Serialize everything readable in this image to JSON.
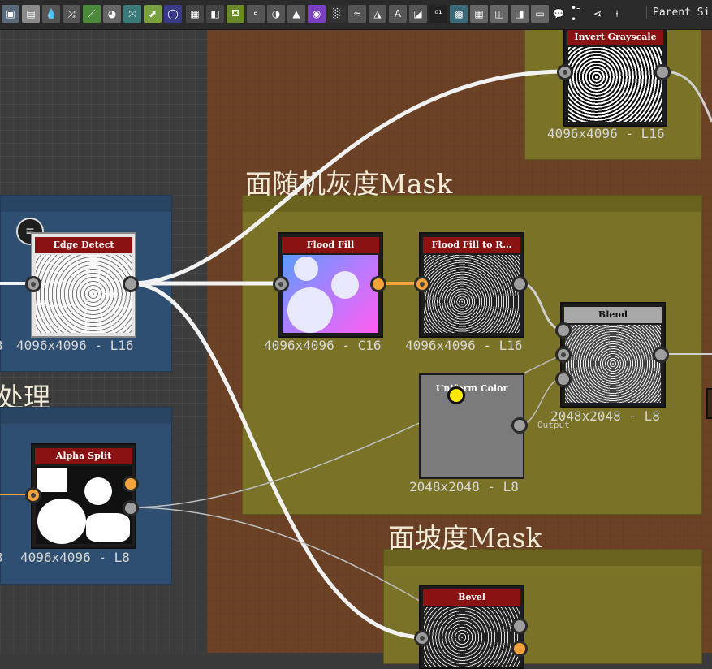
{
  "toolbar": {
    "parent_label": "Parent Si",
    "icons": [
      {
        "name": "image-icon",
        "glyph": "▣",
        "color": "#5a6a7a"
      },
      {
        "name": "bitmap-icon",
        "glyph": "▤",
        "color": "#8a8a8a"
      },
      {
        "name": "drop-icon",
        "glyph": "💧",
        "color": "#555555"
      },
      {
        "name": "shuffle-icon",
        "glyph": "⤨",
        "color": "#555555"
      },
      {
        "name": "curve-icon",
        "glyph": "⟋",
        "color": "#4a8a3a"
      },
      {
        "name": "paint-icon",
        "glyph": "◕",
        "color": "#666666"
      },
      {
        "name": "transform-icon",
        "glyph": "⤧",
        "color": "#3a7a7a"
      },
      {
        "name": "gradient-icon",
        "glyph": "⬈",
        "color": "#7aa040"
      },
      {
        "name": "circle-icon",
        "glyph": "◯",
        "color": "#3a3a8a"
      },
      {
        "name": "grid-icon",
        "glyph": "▦",
        "color": "#444444"
      },
      {
        "name": "bucket-icon",
        "glyph": "◧",
        "color": "#444444"
      },
      {
        "name": "watering-icon",
        "glyph": "⛾",
        "color": "#6a8a2a"
      },
      {
        "name": "slider-icon",
        "glyph": "⚬",
        "color": "#555555"
      },
      {
        "name": "contrast-icon",
        "glyph": "◑",
        "color": "#555555"
      },
      {
        "name": "histogram-icon",
        "glyph": "▲",
        "color": "#555555"
      },
      {
        "name": "color-wheel-icon",
        "glyph": "◉",
        "color": "#7a40c0"
      },
      {
        "name": "noise-icon",
        "glyph": "░",
        "color": "#333333"
      },
      {
        "name": "warp-icon",
        "glyph": "≈",
        "color": "#555555"
      },
      {
        "name": "mirror-icon",
        "glyph": "◮",
        "color": "#555555"
      },
      {
        "name": "text-icon",
        "glyph": "A",
        "color": "#555555"
      },
      {
        "name": "fill-icon",
        "glyph": "◪",
        "color": "#555555"
      },
      {
        "name": "value-icon",
        "glyph": "⁰¹",
        "color": "#222222"
      },
      {
        "name": "pattern-icon",
        "glyph": "▩",
        "color": "#3a6a7a"
      },
      {
        "name": "tile-icon",
        "glyph": "▦",
        "color": "#666666"
      },
      {
        "name": "frame-icon",
        "glyph": "◫",
        "color": "#666666"
      },
      {
        "name": "graph-icon",
        "glyph": "◨",
        "color": "#666666"
      },
      {
        "name": "window-icon",
        "glyph": "▭",
        "color": "#666666"
      },
      {
        "name": "comment-icon",
        "glyph": "💬",
        "color": "#2b2b2b"
      },
      {
        "name": "dot-icon",
        "glyph": "•-•",
        "color": "#2b2b2b"
      },
      {
        "name": "share-icon",
        "glyph": "⋖",
        "color": "#2b2b2b"
      },
      {
        "name": "pin-icon",
        "glyph": "⍿",
        "color": "#2b2b2b"
      }
    ]
  },
  "frames": {
    "top_right": {
      "title": "",
      "color": "#7a7226"
    },
    "random_gray": {
      "title": "面随机灰度Mask",
      "color": "#7a7226"
    },
    "slope": {
      "title": "面坡度Mask",
      "color": "#7a7226"
    },
    "left_top": {
      "title": "",
      "color": "#2f4f72"
    },
    "left_bottom": {
      "title": "",
      "color": "#2f4f72"
    },
    "processing": {
      "title": "处理"
    }
  },
  "nodes": {
    "invert_grayscale": {
      "title": "Invert Grayscale",
      "res": "4096x4096 - L16"
    },
    "edge_detect": {
      "title": "Edge Detect",
      "res": "4096x4096 - L16",
      "res_prefix": "3"
    },
    "flood_fill": {
      "title": "Flood Fill",
      "res": "4096x4096 - C16"
    },
    "flood_fill_to_r": {
      "title": "Flood Fill to R…",
      "res": "4096x4096 - L16"
    },
    "blend": {
      "title": "Blend",
      "res": "2048x2048 - L8"
    },
    "uniform_color": {
      "title": "Uniform Color",
      "res": "2048x2048 - L8",
      "output_label": "Output"
    },
    "alpha_split": {
      "title": "Alpha Split",
      "res": "4096x4096 - L8",
      "res_prefix": "3"
    },
    "bevel": {
      "title": "Bevel"
    }
  },
  "colors": {
    "background_brown": "#6b4226",
    "frame_olive": "#7a7226",
    "frame_blue": "#2f4f72",
    "node_header_red": "#8a1212",
    "wire_white": "#f2f2f2",
    "wire_orange": "#f4a23a"
  }
}
